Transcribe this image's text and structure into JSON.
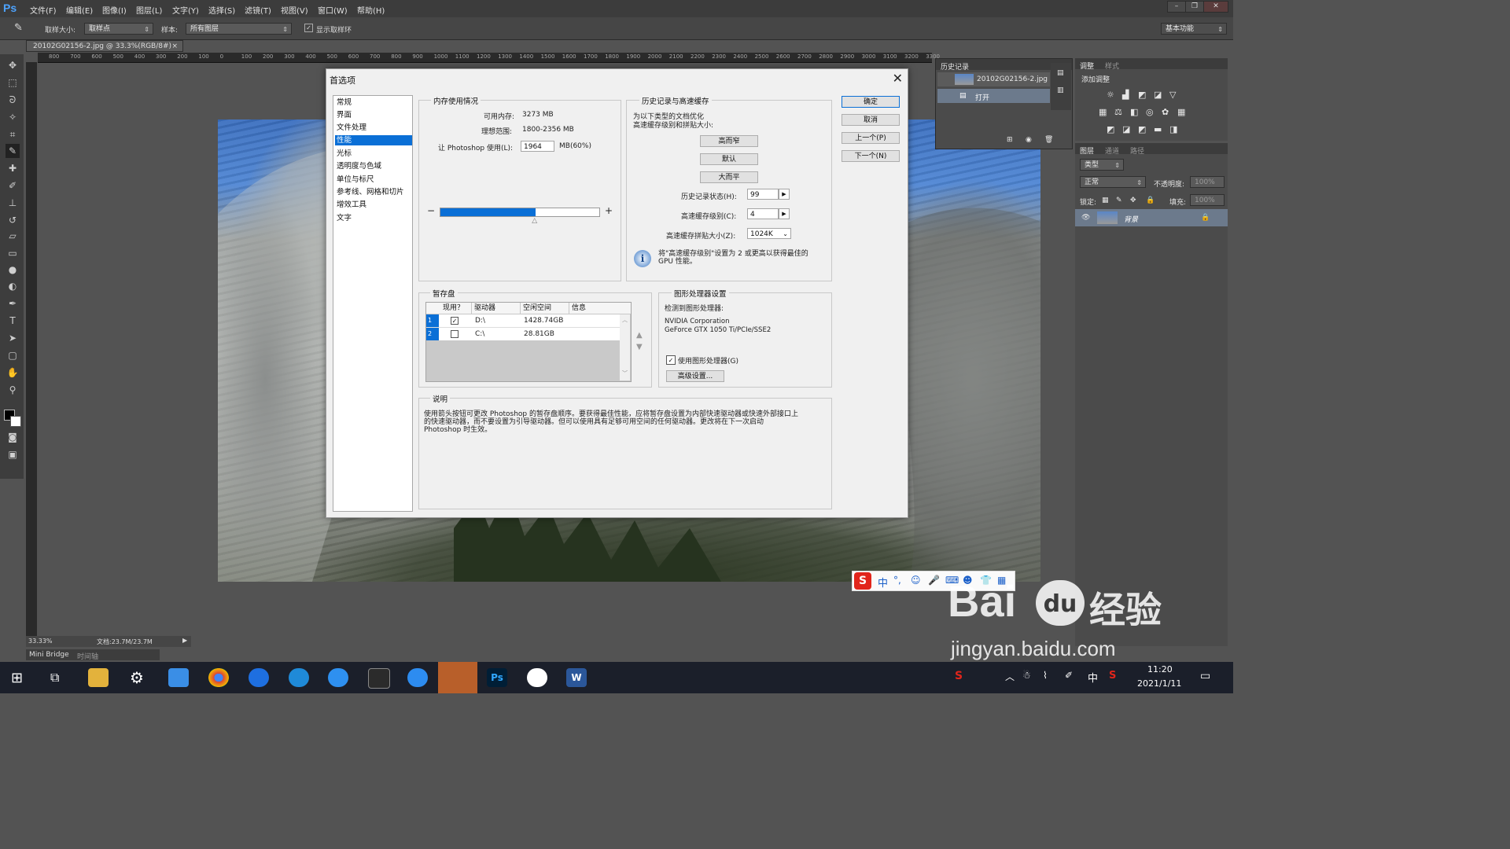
{
  "app": {
    "logo": "Ps",
    "menu": [
      "文件(F)",
      "编辑(E)",
      "图像(I)",
      "图层(L)",
      "文字(Y)",
      "选择(S)",
      "滤镜(T)",
      "视图(V)",
      "窗口(W)",
      "帮助(H)"
    ]
  },
  "options_bar": {
    "sample_size_label": "取样大小:",
    "sample_size_value": "取样点",
    "sample_label": "样本:",
    "sample_value": "所有图层",
    "show_ring_label": "显示取样环",
    "workspace": "基本功能"
  },
  "document": {
    "tab": "20102G02156-2.jpg @ 33.3%(RGB/8#)",
    "ruler_ticks": [
      "800",
      "700",
      "600",
      "500",
      "400",
      "300",
      "200",
      "100",
      "0",
      "100",
      "200",
      "300",
      "400",
      "500",
      "600",
      "700",
      "800",
      "900",
      "1000",
      "1100",
      "1200",
      "1300",
      "1400",
      "1500",
      "1600",
      "1700",
      "1800",
      "1900",
      "2000",
      "2100",
      "2200",
      "2300",
      "2400",
      "2500",
      "2600",
      "2700",
      "2800",
      "2900",
      "3000",
      "3100",
      "3200",
      "3300"
    ]
  },
  "status_bar": {
    "zoom": "33.33%",
    "doc_info": "文档:23.7M/23.7M",
    "mini_bridge": "Mini Bridge",
    "timeline": "时间轴"
  },
  "history_panel": {
    "title": "历史记录",
    "snapshot": "20102G02156-2.jpg",
    "step": "打开"
  },
  "adjust_panel": {
    "tabs": [
      "调整",
      "样式"
    ],
    "add_label": "添加调整"
  },
  "layers_panel": {
    "tabs": [
      "图层",
      "通道",
      "路径"
    ],
    "kind": "类型",
    "blend_mode": "正常",
    "opacity_label": "不透明度:",
    "opacity_value": "100%",
    "lock_label": "锁定:",
    "fill_label": "填充:",
    "fill_value": "100%",
    "layer_name": "背景"
  },
  "dialog": {
    "title": "首选项",
    "nav": [
      "常规",
      "界面",
      "文件处理",
      "性能",
      "光标",
      "透明度与色域",
      "单位与标尺",
      "参考线、网格和切片",
      "增效工具",
      "文字"
    ],
    "active_nav": "性能",
    "memory": {
      "title": "内存使用情况",
      "available_label": "可用内存:",
      "available_value": "3273 MB",
      "ideal_label": "理想范围:",
      "ideal_value": "1800-2356 MB",
      "use_label": "让 Photoshop 使用(L):",
      "use_value": "1964",
      "use_unit": "MB(60%)",
      "slider_percent": 60
    },
    "history_cache": {
      "title": "历史记录与高速缓存",
      "desc_line1": "为以下类型的文档优化",
      "desc_line2": "高速缓存级别和拼贴大小:",
      "btn_tall_thin": "高而窄",
      "btn_default": "默认",
      "btn_big_flat": "大而平",
      "history_states_label": "历史记录状态(H):",
      "history_states_value": "99",
      "cache_levels_label": "高速缓存级别(C):",
      "cache_levels_value": "4",
      "tile_size_label": "高速缓存拼贴大小(Z):",
      "tile_size_value": "1024K",
      "info_line1": "将\"高速缓存级别\"设置为 2 或更高以获得最佳的",
      "info_line2": "GPU 性能。"
    },
    "scratch": {
      "title": "暂存盘",
      "headers": [
        "现用？",
        "驱动器",
        "空闲空间",
        "信息"
      ],
      "rows": [
        {
          "idx": "1",
          "active": "✓",
          "drive": "D:\\",
          "free": "1428.74GB"
        },
        {
          "idx": "2",
          "active": "",
          "drive": "C:\\",
          "free": "28.81GB"
        }
      ]
    },
    "gpu": {
      "title": "图形处理器设置",
      "detected_label": "检测到图形处理器:",
      "vendor": "NVIDIA Corporation",
      "model": "GeForce GTX 1050 Ti/PCIe/SSE2",
      "use_gpu_label": "使用图形处理器(G)",
      "advanced_btn": "高级设置..."
    },
    "description": {
      "title": "说明",
      "line1": "使用箭头按钮可更改 Photoshop 的暂存盘顺序。要获得最佳性能，应将暂存盘设置为内部快速驱动器或快速外部接口上",
      "line2": "的快速驱动器，而不要设置为引导驱动器。但可以使用具有足够可用空间的任何驱动器。更改将在下一次启动",
      "line3": "Photoshop 时生效。"
    },
    "buttons": {
      "ok": "确定",
      "cancel": "取消",
      "prev": "上一个(P)",
      "next": "下一个(N)"
    }
  },
  "ime": {
    "lang": "中"
  },
  "watermark": {
    "brand_left": "Bai",
    "brand_paw": "du",
    "brand_right": "经验",
    "url": "jingyan.baidu.com"
  },
  "taskbar": {
    "time": "11:20",
    "date": "2021/1/11",
    "ime_lang": "中"
  },
  "colors": {
    "accent": "#0a6fd6",
    "ps_blue": "#4da3ff",
    "baidu_red": "#e1251b"
  }
}
